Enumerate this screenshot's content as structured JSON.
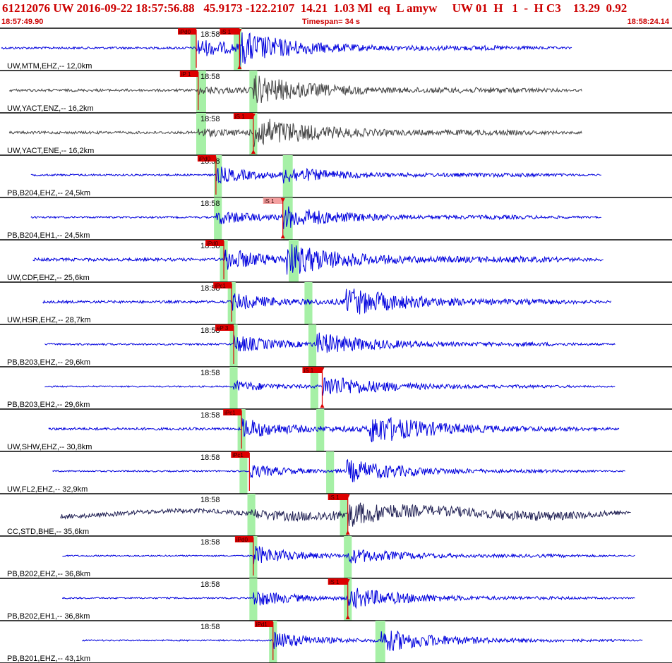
{
  "header": {
    "title_line": "61212076 UW 2016-09-22 18:57:56.88   45.9173 -122.2107  14.21  1.03 Ml  eq  L amyw     UW 01  H   1  -  H C3    13.29  0.92",
    "start_time": "18:57:49.90",
    "timespan": "Timespan=  34 s",
    "end_time": "18:58:24.14"
  },
  "colors": {
    "trace_blue": "#0000dd",
    "trace_gray": "#444444",
    "trace_dark": "#222255",
    "pick_red": "#dd0000",
    "pick_light": "#f4a0a0",
    "window_green": "#a6f0a6",
    "divider": "#000000"
  },
  "chart_data": {
    "type": "seismogram",
    "time_range": [
      "18:57:49.90",
      "18:58:24.14"
    ],
    "timespan_s": 34,
    "minute_tick_label": "18:58",
    "traces": [
      {
        "label": "UW,MTM,EHZ,-- 12,0km",
        "color": "blue",
        "start_s": 0.0,
        "end_s": 29.0,
        "p_time_s": 9.9,
        "s_time_s": 12.1,
        "p_pick": "iPd0",
        "s_pick": "iS 1",
        "p_window_s": [
          9.6,
          9.9
        ],
        "s_window_s": [
          11.8,
          12.2
        ],
        "noise": 0.06,
        "p_amp": 0.5,
        "s_amp": 0.75
      },
      {
        "label": "UW,YACT,ENZ,-- 16,2km",
        "color": "gray",
        "start_s": 0.4,
        "end_s": 29.5,
        "p_time_s": 10.0,
        "s_time_s": 12.8,
        "p_pick": "iP 1",
        "s_pick": "",
        "p_window_s": [
          9.9,
          10.4
        ],
        "s_window_s": [
          12.6,
          13.0
        ],
        "noise": 0.07,
        "p_amp": 0.2,
        "s_amp": 0.75
      },
      {
        "label": "UW,YACT,ENE,-- 16,2km",
        "color": "gray",
        "start_s": 0.4,
        "end_s": 29.5,
        "p_time_s": 10.0,
        "s_time_s": 12.8,
        "p_pick": "",
        "s_pick": "iS 1",
        "p_window_s": [
          9.9,
          10.4
        ],
        "s_window_s": [
          12.6,
          13.0
        ],
        "noise": 0.07,
        "p_amp": 0.2,
        "s_amp": 0.85
      },
      {
        "label": "PB,B204,EHZ,-- 24,5km",
        "color": "blue",
        "start_s": 1.5,
        "end_s": 30.5,
        "p_time_s": 10.9,
        "s_time_s": 14.3,
        "p_pick": "iPd0",
        "s_pick": "",
        "p_window_s": [
          10.8,
          11.2
        ],
        "s_window_s": [
          14.3,
          14.8
        ],
        "noise": 0.05,
        "p_amp": 0.45,
        "s_amp": 0.35
      },
      {
        "label": "PB,B204,EH1,-- 24,5km",
        "color": "blue",
        "start_s": 1.5,
        "end_s": 30.5,
        "p_time_s": 10.9,
        "s_time_s": 14.3,
        "p_pick": "",
        "s_pick": "iS 1",
        "p_window_s": [
          10.8,
          11.2
        ],
        "s_window_s": [
          14.3,
          14.8
        ],
        "noise": 0.05,
        "p_amp": 0.4,
        "s_amp": 0.55
      },
      {
        "label": "UW,CDF,EHZ,-- 25,6km",
        "color": "blue",
        "start_s": 1.6,
        "end_s": 30.6,
        "p_time_s": 11.3,
        "s_time_s": 14.5,
        "p_pick": "iPd0",
        "s_pick": "",
        "p_window_s": [
          11.1,
          11.5
        ],
        "s_window_s": [
          14.6,
          15.1
        ],
        "noise": 0.08,
        "p_amp": 0.6,
        "s_amp": 0.75
      },
      {
        "label": "UW,HSR,EHZ,-- 28,7km",
        "color": "blue",
        "start_s": 2.1,
        "end_s": 31.0,
        "p_time_s": 11.7,
        "s_time_s": 17.5,
        "p_pick": "iPc1",
        "s_pick": "",
        "p_window_s": [
          11.5,
          11.9
        ],
        "s_window_s": [
          15.4,
          15.8
        ],
        "noise": 0.07,
        "p_amp": 0.45,
        "s_amp": 0.75
      },
      {
        "label": "PB,B203,EHZ,-- 29,6km",
        "color": "blue",
        "start_s": 2.2,
        "end_s": 31.2,
        "p_time_s": 11.8,
        "s_time_s": 16.0,
        "p_pick": "eP 3",
        "s_pick": "",
        "p_window_s": [
          11.6,
          12.0
        ],
        "s_window_s": [
          15.6,
          16.0
        ],
        "noise": 0.05,
        "p_amp": 0.5,
        "s_amp": 0.55
      },
      {
        "label": "PB,B203,EH2,-- 29,6km",
        "color": "blue",
        "start_s": 2.2,
        "end_s": 31.2,
        "p_time_s": 11.8,
        "s_time_s": 16.3,
        "p_pick": "",
        "s_pick": "iS 1",
        "p_window_s": [
          11.6,
          12.0
        ],
        "s_window_s": [
          15.7,
          16.1
        ],
        "noise": 0.04,
        "p_amp": 0.3,
        "s_amp": 0.6
      },
      {
        "label": "UW,SHW,EHZ,-- 30,8km",
        "color": "blue",
        "start_s": 2.4,
        "end_s": 31.4,
        "p_time_s": 12.2,
        "s_time_s": 18.7,
        "p_pick": "iPc1",
        "s_pick": "",
        "p_window_s": [
          12.0,
          12.4
        ],
        "s_window_s": [
          16.0,
          16.4
        ],
        "noise": 0.07,
        "p_amp": 0.55,
        "s_amp": 0.8
      },
      {
        "label": "UW,FL2,EHZ,-- 32,9km",
        "color": "blue",
        "start_s": 2.6,
        "end_s": 31.7,
        "p_time_s": 12.6,
        "s_time_s": 17.5,
        "p_pick": "iPc1",
        "s_pick": "",
        "p_window_s": [
          12.1,
          12.5
        ],
        "s_window_s": [
          16.5,
          16.9
        ],
        "noise": 0.04,
        "p_amp": 0.35,
        "s_amp": 0.6
      },
      {
        "label": "CC,STD,BHE,-- 35,6km",
        "color": "dark",
        "start_s": 3.0,
        "end_s": 32.0,
        "p_time_s": 12.7,
        "s_time_s": 17.6,
        "p_pick": "",
        "s_pick": "iS 1",
        "p_window_s": [
          12.5,
          12.9
        ],
        "s_window_s": [
          17.2,
          17.6
        ],
        "noise": 0.12,
        "p_amp": 0.2,
        "s_amp": 0.6
      },
      {
        "label": "PB,B202,EHZ,-- 36,8km",
        "color": "blue",
        "start_s": 3.1,
        "end_s": 32.2,
        "p_time_s": 12.8,
        "s_time_s": 17.6,
        "p_pick": "iPd0",
        "s_pick": "",
        "p_window_s": [
          12.6,
          13.0
        ],
        "s_window_s": [
          17.4,
          17.8
        ],
        "noise": 0.04,
        "p_amp": 0.55,
        "s_amp": 0.35
      },
      {
        "label": "PB,B202,EH1,-- 36,8km",
        "color": "blue",
        "start_s": 3.1,
        "end_s": 32.2,
        "p_time_s": 12.8,
        "s_time_s": 17.6,
        "p_pick": "",
        "s_pick": "iS 1",
        "p_window_s": [
          12.6,
          13.0
        ],
        "s_window_s": [
          17.4,
          17.8
        ],
        "noise": 0.04,
        "p_amp": 0.45,
        "s_amp": 0.55
      },
      {
        "label": "PB,B201,EHZ,-- 43,1km",
        "color": "blue",
        "start_s": 4.1,
        "end_s": 32.6,
        "p_time_s": 13.8,
        "s_time_s": 19.3,
        "p_pick": "iPd1",
        "s_pick": "",
        "p_window_s": [
          13.6,
          14.0
        ],
        "s_window_s": [
          19.0,
          19.5
        ],
        "noise": 0.04,
        "p_amp": 0.5,
        "s_amp": 0.6
      }
    ]
  }
}
